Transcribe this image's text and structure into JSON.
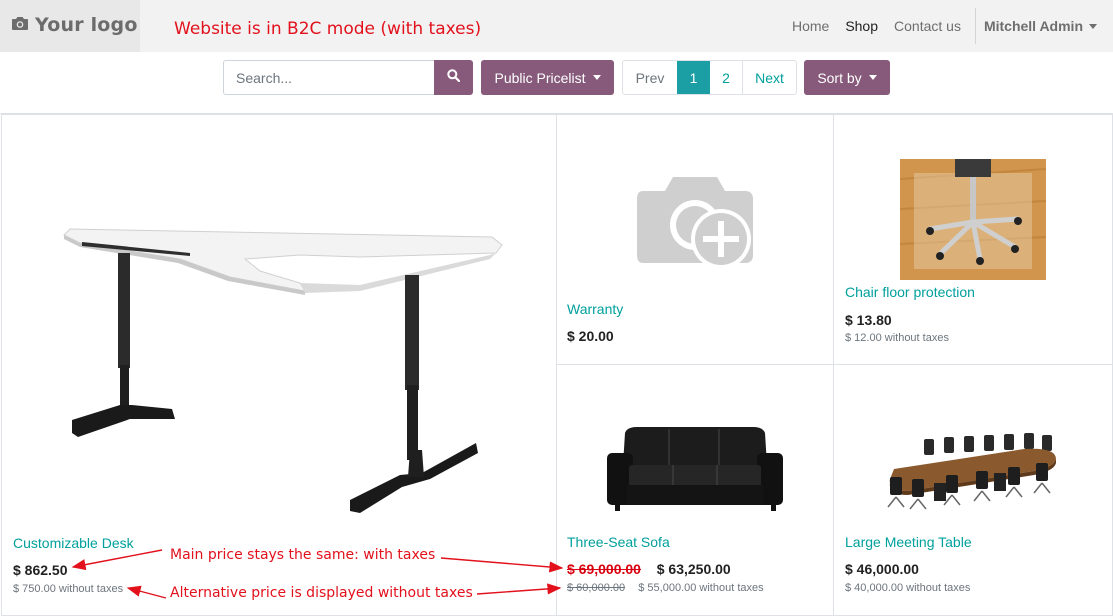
{
  "header": {
    "logo_text": "Your logo",
    "mode_note": "Website is in B2C mode (with taxes)",
    "nav": [
      {
        "label": "Home"
      },
      {
        "label": "Shop"
      },
      {
        "label": "Contact us"
      }
    ],
    "user": "Mitchell Admin"
  },
  "toolbar": {
    "search_placeholder": "Search...",
    "pricelist_label": "Public Pricelist",
    "pager": {
      "prev": "Prev",
      "pages": [
        "1",
        "2"
      ],
      "current": "1",
      "next": "Next"
    },
    "sort_label": "Sort by"
  },
  "products": [
    {
      "name": "Customizable Desk",
      "price": "$ 862.50",
      "alt_price": "$ 750.00 without taxes"
    },
    {
      "name": "Warranty",
      "price": "$ 20.00"
    },
    {
      "name": "Chair floor protection",
      "price": "$ 13.80",
      "alt_price": "$ 12.00 without taxes"
    },
    {
      "name": "Three-Seat Sofa",
      "old_price": "$ 69,000.00",
      "price": "$ 63,250.00",
      "old_alt_price": "$ 60,000.00",
      "alt_price": "$ 55,000.00 without taxes"
    },
    {
      "name": "Large Meeting Table",
      "price": "$ 46,000.00",
      "alt_price": "$ 40,000.00 without taxes"
    }
  ],
  "annotations": {
    "main_price": "Main price stays the same: with taxes",
    "alt_price": "Alternative price is displayed without taxes"
  },
  "colors": {
    "brand": "#875a7b",
    "link": "#00a09d",
    "annotation": "#e2111c",
    "pager_active": "#1b9ea4"
  }
}
